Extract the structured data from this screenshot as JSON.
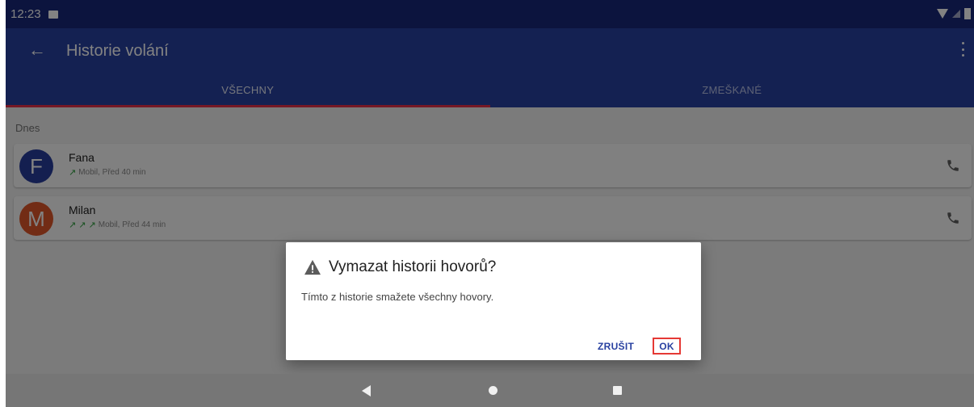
{
  "status_bar": {
    "time": "12:23"
  },
  "app_bar": {
    "title": "Historie volání",
    "tabs": [
      {
        "label": "VŠECHNY",
        "active": true
      },
      {
        "label": "ZMEŠKANÉ",
        "active": false
      }
    ]
  },
  "content": {
    "section_header": "Dnes",
    "calls": [
      {
        "initial": "F",
        "name": "Fana",
        "arrows": "↗",
        "detail": "Mobil, Před 40 min",
        "avatar_color": "#283d9e"
      },
      {
        "initial": "M",
        "name": "Milan",
        "arrows": "↗ ↗ ↗",
        "detail": "Mobil, Před 44 min",
        "avatar_color": "#e0562a"
      }
    ]
  },
  "dialog": {
    "title": "Vymazat historii hovorů?",
    "message": "Tímto z historie smažete všechny hovory.",
    "cancel_label": "ZRUŠIT",
    "ok_label": "OK"
  },
  "colors": {
    "status_bar": "#19297a",
    "app_bar": "#2941a1",
    "tab_indicator": "#e8304a",
    "call_arrow": "#2e9e3e",
    "dialog_button": "#2941a1"
  }
}
